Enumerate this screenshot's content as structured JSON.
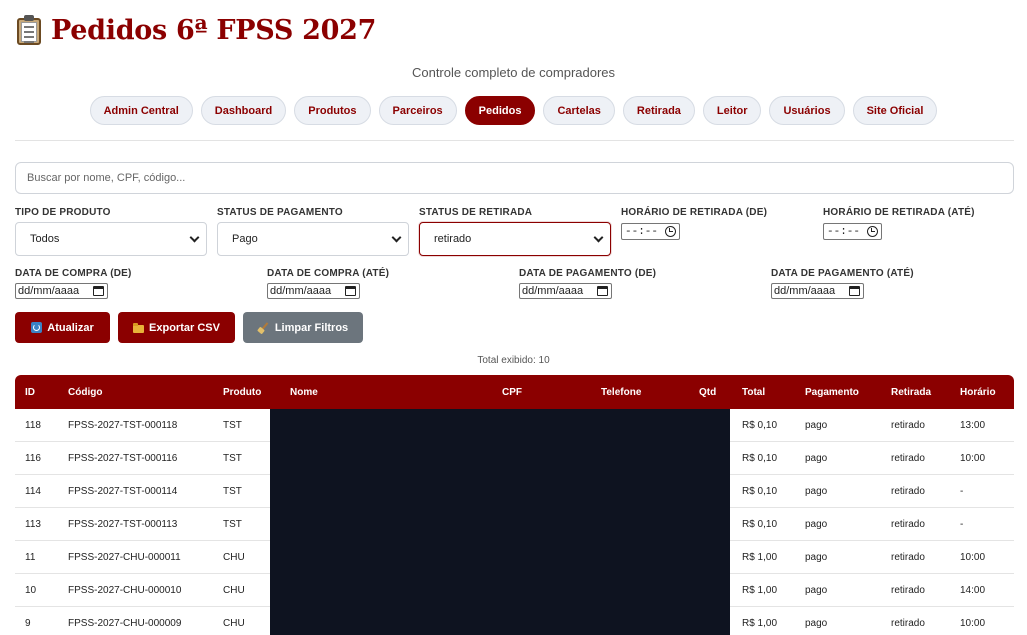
{
  "header": {
    "title": "Pedidos 6ª FPSS 2027",
    "icon": "clipboard-icon",
    "subtitle": "Controle completo de compradores"
  },
  "nav": [
    {
      "label": "Admin Central",
      "active": false
    },
    {
      "label": "Dashboard",
      "active": false
    },
    {
      "label": "Produtos",
      "active": false
    },
    {
      "label": "Parceiros",
      "active": false
    },
    {
      "label": "Pedidos",
      "active": true
    },
    {
      "label": "Cartelas",
      "active": false
    },
    {
      "label": "Retirada",
      "active": false
    },
    {
      "label": "Leitor",
      "active": false
    },
    {
      "label": "Usuários",
      "active": false
    },
    {
      "label": "Site Oficial",
      "active": false
    }
  ],
  "search": {
    "placeholder": "Buscar por nome, CPF, código..."
  },
  "filters": {
    "tipo_produto": {
      "label": "TIPO DE PRODUTO",
      "value": "Todos"
    },
    "status_pagamento": {
      "label": "STATUS DE PAGAMENTO",
      "value": "Pago"
    },
    "status_retirada": {
      "label": "STATUS DE RETIRADA",
      "value": "retirado"
    },
    "horario_de": {
      "label": "HORÁRIO DE RETIRADA (DE)",
      "value": "--:--"
    },
    "horario_ate": {
      "label": "HORÁRIO DE RETIRADA (ATÉ)",
      "value": "--:--"
    },
    "compra_de": {
      "label": "DATA DE COMPRA (DE)",
      "value": "dd/mm/aaaa"
    },
    "compra_ate": {
      "label": "DATA DE COMPRA (ATÉ)",
      "value": "dd/mm/aaaa"
    },
    "pagamento_de": {
      "label": "DATA DE PAGAMENTO (DE)",
      "value": "dd/mm/aaaa"
    },
    "pagamento_ate": {
      "label": "DATA DE PAGAMENTO (ATÉ)",
      "value": "dd/mm/aaaa"
    }
  },
  "actions": {
    "atualizar": "Atualizar",
    "exportar": "Exportar CSV",
    "limpar": "Limpar Filtros"
  },
  "total_text": "Total exibido: 10",
  "table": {
    "columns": [
      "ID",
      "Código",
      "Produto",
      "Nome",
      "CPF",
      "Telefone",
      "Qtd",
      "Total",
      "Pagamento",
      "Retirada",
      "Horário"
    ],
    "rows": [
      {
        "id": "118",
        "codigo": "FPSS-2027-TST-000118",
        "produto": "TST",
        "total": "R$ 0,10",
        "pagamento": "pago",
        "retirada": "retirado",
        "horario": "13:00"
      },
      {
        "id": "116",
        "codigo": "FPSS-2027-TST-000116",
        "produto": "TST",
        "total": "R$ 0,10",
        "pagamento": "pago",
        "retirada": "retirado",
        "horario": "10:00"
      },
      {
        "id": "114",
        "codigo": "FPSS-2027-TST-000114",
        "produto": "TST",
        "total": "R$ 0,10",
        "pagamento": "pago",
        "retirada": "retirado",
        "horario": "-"
      },
      {
        "id": "113",
        "codigo": "FPSS-2027-TST-000113",
        "produto": "TST",
        "total": "R$ 0,10",
        "pagamento": "pago",
        "retirada": "retirado",
        "horario": "-"
      },
      {
        "id": "11",
        "codigo": "FPSS-2027-CHU-000011",
        "produto": "CHU",
        "total": "R$ 1,00",
        "pagamento": "pago",
        "retirada": "retirado",
        "horario": "10:00"
      },
      {
        "id": "10",
        "codigo": "FPSS-2027-CHU-000010",
        "produto": "CHU",
        "total": "R$ 1,00",
        "pagamento": "pago",
        "retirada": "retirado",
        "horario": "14:00"
      },
      {
        "id": "9",
        "codigo": "FPSS-2027-CHU-000009",
        "produto": "CHU",
        "total": "R$ 1,00",
        "pagamento": "pago",
        "retirada": "retirado",
        "horario": "10:00"
      }
    ]
  },
  "colors": {
    "accent": "#8b0000",
    "redaction": "#0e1320",
    "nav_bg": "#eef1f6",
    "gray_button": "#6c757d"
  }
}
